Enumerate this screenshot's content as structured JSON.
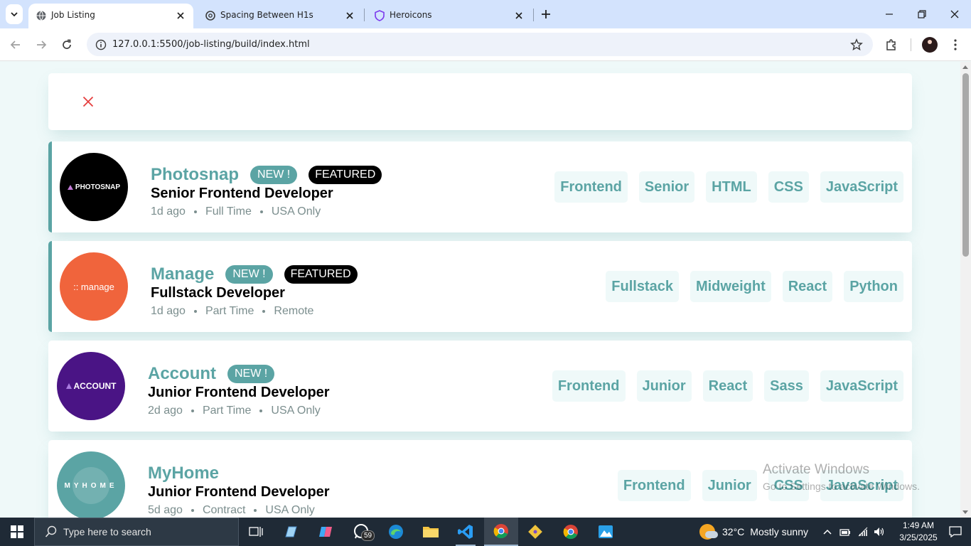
{
  "browser": {
    "tabs": [
      {
        "title": "Job Listing",
        "icon": "globe-icon",
        "active": true
      },
      {
        "title": "Spacing Between H1s",
        "icon": "openai-icon",
        "active": false
      },
      {
        "title": "Heroicons",
        "icon": "shield-icon",
        "active": false
      }
    ],
    "url": "127.0.0.1:5500/job-listing/build/index.html"
  },
  "filter_bar": {
    "clear_icon": "close-icon",
    "clear_color": "#e53e3e"
  },
  "jobs": [
    {
      "company": "Photosnap",
      "logo_text": "PHOTOSNAP",
      "logo_color": "#000000",
      "new": "NEW !",
      "featured": "FEATURED",
      "position": "Senior Frontend Developer",
      "posted": "1d ago",
      "contract": "Full Time",
      "location": "USA Only",
      "tags": [
        "Frontend",
        "Senior",
        "HTML",
        "CSS",
        "JavaScript"
      ]
    },
    {
      "company": "Manage",
      "logo_text": ":: manage",
      "logo_color": "#f0643c",
      "new": "NEW !",
      "featured": "FEATURED",
      "position": "Fullstack Developer",
      "posted": "1d ago",
      "contract": "Part Time",
      "location": "Remote",
      "tags": [
        "Fullstack",
        "Midweight",
        "React",
        "Python"
      ]
    },
    {
      "company": "Account",
      "logo_text": "ACCOUNT",
      "logo_color": "#4a1485",
      "new": "NEW !",
      "position": "Junior Frontend Developer",
      "posted": "2d ago",
      "contract": "Part Time",
      "location": "USA Only",
      "tags": [
        "Frontend",
        "Junior",
        "React",
        "Sass",
        "JavaScript"
      ]
    },
    {
      "company": "MyHome",
      "logo_text": "MYHOME",
      "logo_color": "#5ba4a4",
      "position": "Junior Frontend Developer",
      "posted": "5d ago",
      "contract": "Contract",
      "location": "USA Only",
      "tags": [
        "Frontend",
        "Junior",
        "CSS",
        "JavaScript"
      ]
    }
  ],
  "watermark": {
    "line1": "Activate Windows",
    "line2": "Go to Settings to activate Windows."
  },
  "taskbar": {
    "search_placeholder": "Type here to search",
    "whatsapp_badge": "59",
    "weather": {
      "temp": "32°C",
      "condition": "Mostly sunny"
    },
    "time": "1:49 AM",
    "date": "3/25/2025"
  },
  "colors": {
    "accent": "#5ba4a4",
    "background": "#eff9f9",
    "tab_strip": "#d3e3fd"
  }
}
